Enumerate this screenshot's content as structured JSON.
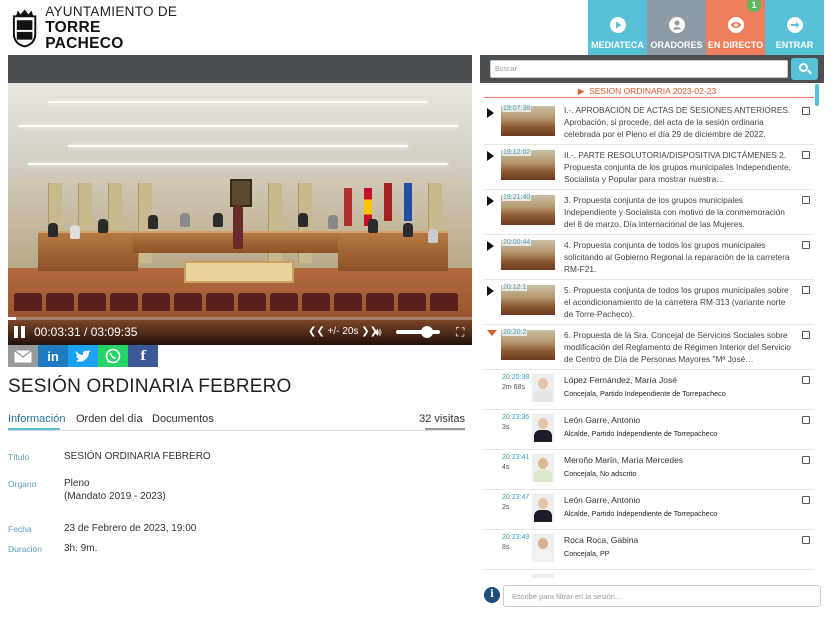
{
  "header": {
    "logo_line1": "AYUNTAMIENTO DE",
    "logo_line2": "TORRE PACHECO",
    "nav": [
      {
        "label": "MEDIATECA",
        "icon": "play-circle-icon",
        "color": "#56c1d7"
      },
      {
        "label": "ORADORES",
        "icon": "user-icon",
        "color": "#8c9ba6"
      },
      {
        "label": "EN DIRECTO",
        "icon": "eye-icon",
        "color": "#f07f5c",
        "badge": "1"
      },
      {
        "label": "ENTRAR",
        "icon": "login-arrow-icon",
        "color": "#56c1d7"
      }
    ]
  },
  "player": {
    "time": "00:03:31 / 03:09:35",
    "skip_label": "+/- 20s",
    "progress_fraction": 0.018,
    "volume_fraction": 0.7
  },
  "share": [
    "email",
    "linkedin",
    "twitter",
    "whatsapp",
    "facebook"
  ],
  "page": {
    "title": "SESIÓN ORDINARIA FEBRERO",
    "tabs": [
      "Información",
      "Orden del día",
      "Documentos"
    ],
    "active_tab": "Información",
    "visits": "32 visitas"
  },
  "info": {
    "titulo_label": "Título",
    "titulo_value": "SESIÓN ORDINARIA FEBRERO",
    "organo_label": "Órgano",
    "organo_value": "Pleno",
    "organo_value2": "(Mandato 2019 - 2023)",
    "fecha_label": "Fecha",
    "fecha_value": "23 de Febrero de 2023, 19:00",
    "duracion_label": "Duración",
    "duracion_value": "3h. 9m."
  },
  "sidebar": {
    "search_placeholder": "Buscar",
    "session_title": "SESION ORDINARIA 2023-02-23",
    "agenda": [
      {
        "time": "19:07:38",
        "text": "I.-. APROBACIÓN DE ACTAS DE SESIONES ANTERIORES. Aprobación, si procede, del acta de la sesión ordinaria celebrada por el Pleno el día 29 de diciembre de 2022."
      },
      {
        "time": "19:12:02",
        "text": "II.-. PARTE RESOLUTORIA/DISPOSITIVA DICTÁMENES 2. Propuesta conjunta de los grupos municipales Independiente, Socialista y Popular para mostrar nuestra…"
      },
      {
        "time": "19:21:40",
        "text": "3. Propuesta conjunta de los grupos municipales Independiente y Socialista con motivo de la conmemoración del 8 de marzo, Día Internacional de las Mujeres."
      },
      {
        "time": "20:00:44",
        "text": "4. Propuesta conjunta de todos los grupos municipales solicitando al Gobierno Regional la reparación de la carretera RM-F21."
      },
      {
        "time": "20:12:1",
        "text": "5. Propuesta conjunta de todos los grupos municipales sobre el acondicionamiento de la carretera RM-313 (variante norte de Torre-Pacheco)."
      },
      {
        "time": "20:20:2",
        "text": "6. Propuesta de la Sra. Concejal de Servicios Sociales sobre modificación del Reglamento de Régimen Interior del Servicio de Centro de Día de Personas Mayores \"Mª José…"
      }
    ],
    "speakers": [
      {
        "time": "20:20:38",
        "duration": "2m 68s",
        "name": "López Fernández, María José",
        "role": "Concejala, Partido Independiente de Torrepacheco",
        "gender": "f"
      },
      {
        "time": "20:23:36",
        "duration": "3s",
        "name": "León Garre, Antonio",
        "role": "Alcalde, Partido Independiente de Torrepacheco",
        "gender": "m"
      },
      {
        "time": "20:23:41",
        "duration": "4s",
        "name": "Meroño Marín, María Mercedes",
        "role": "Concejala, No adscrito",
        "gender": "f"
      },
      {
        "time": "20:23:47",
        "duration": "2s",
        "name": "León Garre, Antonio",
        "role": "Alcalde, Partido Independiente de Torrepacheco",
        "gender": "m"
      },
      {
        "time": "20:23:49",
        "duration": "8s",
        "name": "Roca Roca, Gabina",
        "role": "Concejala, PP",
        "gender": "f"
      }
    ],
    "filter_placeholder": "Escribe para filtrar en la sesión..."
  }
}
